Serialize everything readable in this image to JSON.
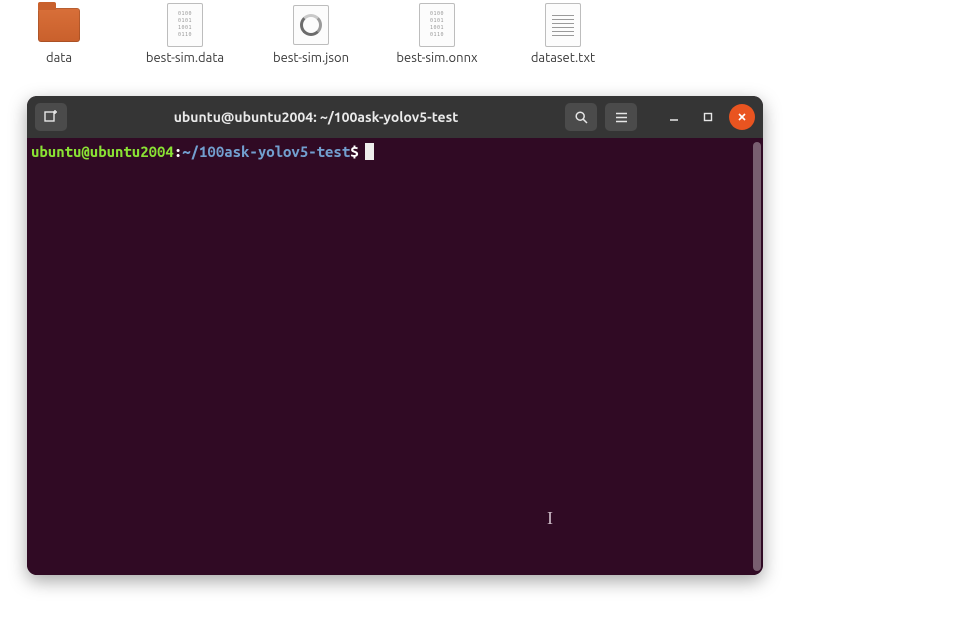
{
  "desktop": {
    "items": [
      {
        "label": "data",
        "kind": "folder"
      },
      {
        "label": "best-sim.data",
        "kind": "textdoc"
      },
      {
        "label": "best-sim.json",
        "kind": "textdoc"
      },
      {
        "label": "best-sim.onnx",
        "kind": "onnx"
      },
      {
        "label": "best-sim.onnx",
        "kind": "textdoc"
      },
      {
        "label": "dataset.txt",
        "kind": "plaindoc"
      }
    ]
  },
  "terminal": {
    "title": "ubuntu@ubuntu2004: ~/100ask-yolov5-test",
    "prompt": {
      "user_host": "ubuntu@ubuntu2004",
      "colon": ":",
      "path": "~/100ask-yolov5-test",
      "symbol": "$"
    },
    "doc_bits": "0100\n0101\n1001\n0110"
  }
}
